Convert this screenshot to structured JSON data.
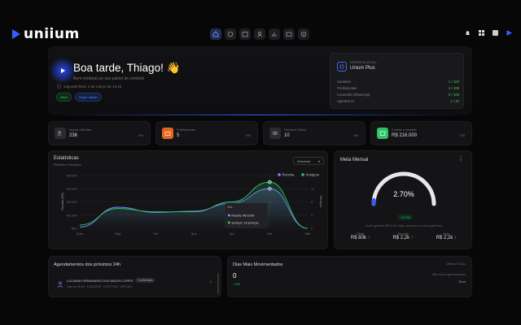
{
  "app": {
    "name": "uniium"
  },
  "greeting": {
    "title": "Boa tarde, Thiago! 👋",
    "subtitle": "Bem-vindo(a) ao seu painel de controle",
    "date": "segunda-feira, 4 de março de 16:15",
    "tags": [
      "Ativo",
      "Super admin"
    ]
  },
  "company": {
    "label": "EMPRESA ATUAL",
    "name": "Unium Plus",
    "rows": [
      {
        "label": "Usuários",
        "value": "1 / 100"
      },
      {
        "label": "Profissionais",
        "value": "1 / 100"
      },
      {
        "label": "Conexões WhatsApp",
        "value": "0 / 100"
      },
      {
        "label": "Agentes IA",
        "value": "1 / 10"
      }
    ]
  },
  "stats": [
    {
      "label": "Novos Clientes",
      "value": "236",
      "pct": "0%",
      "color": "#2a2a30",
      "icon": "users-icon"
    },
    {
      "label": "Profissionais",
      "value": "5",
      "pct": "0%",
      "color": "#e8641b",
      "icon": "briefcase-icon"
    },
    {
      "label": "Serviços Feitos",
      "value": "10",
      "pct": "0%",
      "color": "#2a2a30",
      "icon": "eye-icon"
    },
    {
      "label": "Contas a receber",
      "value": "R$ 216.000",
      "pct": "0%",
      "color": "#2ec266",
      "icon": "wallet-icon"
    }
  ],
  "chart": {
    "title": "Estatísticas",
    "subtitle": "Receita e Serviços",
    "period": "Semanal",
    "tooltip": {
      "label": "Sex",
      "revenue": "Receita: R$ 6.000",
      "services": "Serviços: 14 serviços"
    }
  },
  "chart_data": {
    "type": "area",
    "categories": [
      "Dom",
      "Seg",
      "Ter",
      "Qua",
      "Qui",
      "Sex",
      "Sáb"
    ],
    "ylabel": "Receita (R$)",
    "y2label": "Serviços",
    "yticks": [
      "R$ 8000",
      "R$ 6000",
      "R$ 4000",
      "R$ 2000",
      "R$ 0"
    ],
    "y2ticks": [
      "16",
      "12",
      "8",
      "4",
      "0"
    ],
    "ylim": [
      0,
      8000
    ],
    "y2lim": [
      0,
      16
    ],
    "series": [
      {
        "name": "Receita",
        "axis": "left",
        "color": "#7a84ff",
        "values": [
          200,
          3200,
          2400,
          2600,
          3800,
          6000,
          0
        ]
      },
      {
        "name": "Serviços",
        "axis": "right",
        "color": "#2ec266",
        "values": [
          1,
          6,
          5,
          5,
          8,
          14,
          0
        ]
      }
    ],
    "legend": "top-right"
  },
  "meta": {
    "title": "Meta Mensal",
    "percent": "2.70%",
    "badge": "+2.7%",
    "note": "Você ganhou R$ 2,2k hoje, superou os seus ganhos!",
    "progress": 0.027,
    "items": [
      {
        "label": "Meta",
        "value": "R$ 80k"
      },
      {
        "label": "Receita",
        "value": "R$ 2,2k"
      },
      {
        "label": "Hoje",
        "value": "R$ 2,2k"
      }
    ]
  },
  "schedule": {
    "title": "Agendamentos dos próximos 24h",
    "name": "LUCIANA FERNANDES DOS ANJOS LOPES",
    "status": "Confirmado",
    "detail": "Hoje às 09:00 · 10/03/2025 · ESTÉTICA · SERVIÇO"
  },
  "days": {
    "title": "Dias Mais Movimentados",
    "period_label": "Últimos 30 dias",
    "value": "0",
    "pct": "↑ 0%",
    "side_note": "Não houve agendamentos",
    "side_value": "Dom"
  }
}
